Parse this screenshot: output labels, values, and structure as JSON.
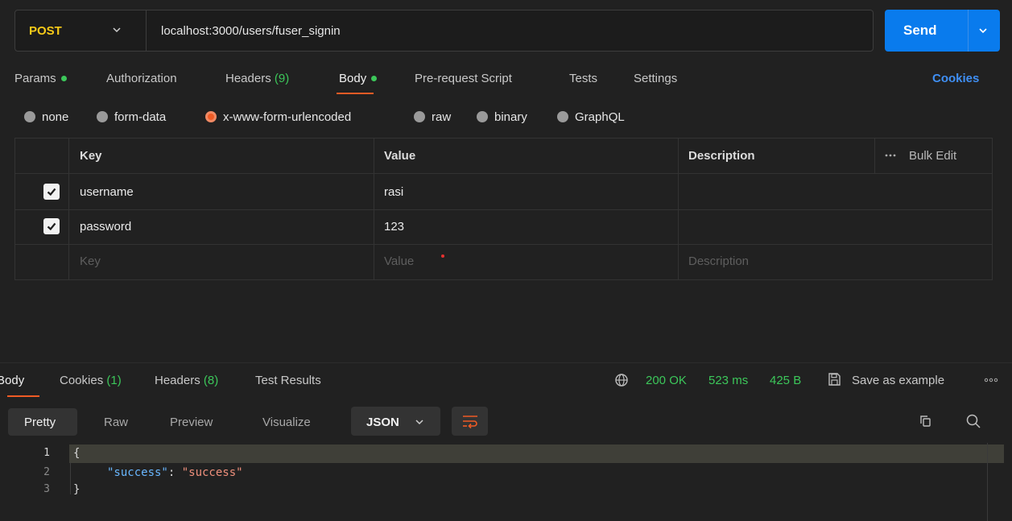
{
  "request": {
    "method": "POST",
    "url": "localhost:3000/users/fuser_signin",
    "send_label": "Send"
  },
  "req_tabs": {
    "params": "Params",
    "authorization": "Authorization",
    "headers": "Headers",
    "headers_count": "(9)",
    "body": "Body",
    "prerequest": "Pre-request Script",
    "tests": "Tests",
    "settings": "Settings",
    "cookies": "Cookies"
  },
  "body_types": [
    "none",
    "form-data",
    "x-www-form-urlencoded",
    "raw",
    "binary",
    "GraphQL"
  ],
  "body_type_selected": "x-www-form-urlencoded",
  "table": {
    "headers": {
      "key": "Key",
      "value": "Value",
      "description": "Description",
      "bulk_edit": "Bulk Edit"
    },
    "rows": [
      {
        "key": "username",
        "value": "rasi",
        "checked": true
      },
      {
        "key": "password",
        "value": "123",
        "checked": true
      }
    ],
    "placeholders": {
      "key": "Key",
      "value": "Value",
      "description": "Description"
    }
  },
  "response": {
    "tabs": {
      "body": "Body",
      "cookies": "Cookies",
      "cookies_count": "(1)",
      "headers": "Headers",
      "headers_count": "(8)",
      "test_results": "Test Results"
    },
    "status": "200 OK",
    "time": "523 ms",
    "size": "425 B",
    "save_example": "Save as example",
    "views": {
      "pretty": "Pretty",
      "raw": "Raw",
      "preview": "Preview",
      "visualize": "Visualize"
    },
    "format": "JSON",
    "code": {
      "line_numbers": [
        "1",
        "2",
        "3"
      ],
      "open_brace": "{",
      "key": "\"success\"",
      "colon": ": ",
      "value": "\"success\"",
      "close_brace": "}"
    }
  },
  "colors": {
    "accent": "#ef5b25",
    "send": "#097bed",
    "method": "#f7ca18",
    "status_ok": "#3cc75a",
    "json_key": "#69b7ff",
    "json_string": "#f0907c"
  },
  "icons": {
    "method_dropdown": "chevron-down-icon",
    "send_dropdown": "chevron-down-icon",
    "more": "ellipsis-icon",
    "network": "globe-icon",
    "save": "save-icon",
    "wrap": "wrap-lines-icon",
    "copy": "copy-icon",
    "search": "search-icon"
  }
}
